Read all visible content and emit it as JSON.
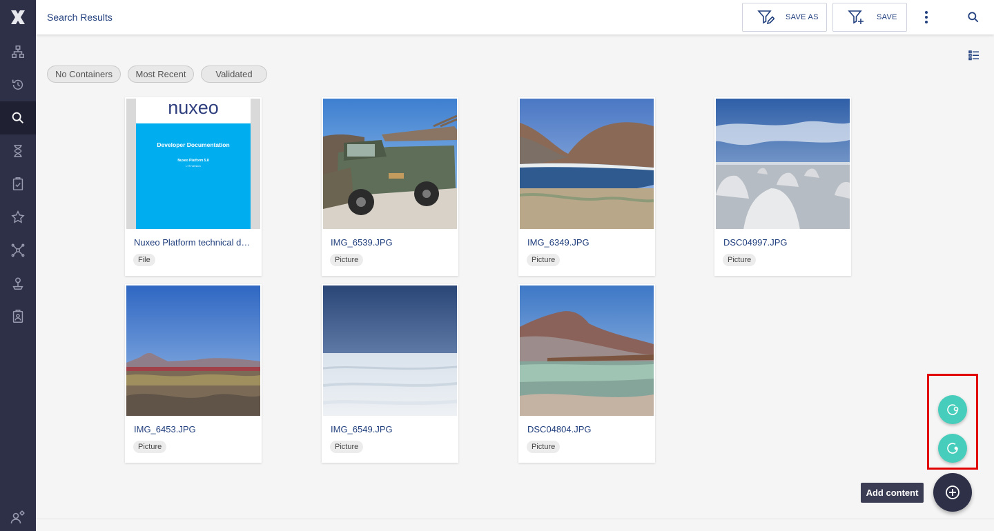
{
  "header": {
    "title": "Search Results",
    "save_as_label": "SAVE AS",
    "save_label": "SAVE"
  },
  "sidebar": {
    "items": [
      {
        "icon": "sitemap-icon",
        "label": "Browse"
      },
      {
        "icon": "history-icon",
        "label": "Recently viewed"
      },
      {
        "icon": "search-icon",
        "label": "Search",
        "active": true
      },
      {
        "icon": "hourglass-icon",
        "label": "Expired"
      },
      {
        "icon": "clipboard-check-icon",
        "label": "Tasks"
      },
      {
        "icon": "star-icon",
        "label": "Favorites"
      },
      {
        "icon": "collections-icon",
        "label": "Collections"
      },
      {
        "icon": "personal-space-icon",
        "label": "Personal workspace"
      },
      {
        "icon": "badge-icon",
        "label": "Administration"
      }
    ],
    "bottom_icon": "user-settings-icon"
  },
  "filters": {
    "chips": [
      "No Containers",
      "Most Recent",
      "Validated"
    ]
  },
  "results": [
    {
      "title": "Nuxeo Platform technical documentation",
      "type": "File",
      "thumb_kind": "document",
      "doc_brand": "nuxeo",
      "doc_title": "Developer Documentation",
      "doc_subtitle": "Nuxeo Platform 5.8",
      "doc_version": "LTS Version"
    },
    {
      "title": "IMG_6539.JPG",
      "type": "Picture",
      "thumb_kind": "truck"
    },
    {
      "title": "IMG_6349.JPG",
      "type": "Picture",
      "thumb_kind": "lagoon"
    },
    {
      "title": "DSC04997.JPG",
      "type": "Picture",
      "thumb_kind": "salt"
    },
    {
      "title": "IMG_6453.JPG",
      "type": "Picture",
      "thumb_kind": "plain"
    },
    {
      "title": "IMG_6549.JPG",
      "type": "Picture",
      "thumb_kind": "saltflat"
    },
    {
      "title": "DSC04804.JPG",
      "type": "Picture",
      "thumb_kind": "volcano"
    }
  ],
  "actions": {
    "tooltip": "Add content"
  },
  "colors": {
    "sidebar": "#2e3047",
    "accent": "#47cdbb",
    "text": "#213f7d",
    "highlight": "#e10000"
  }
}
